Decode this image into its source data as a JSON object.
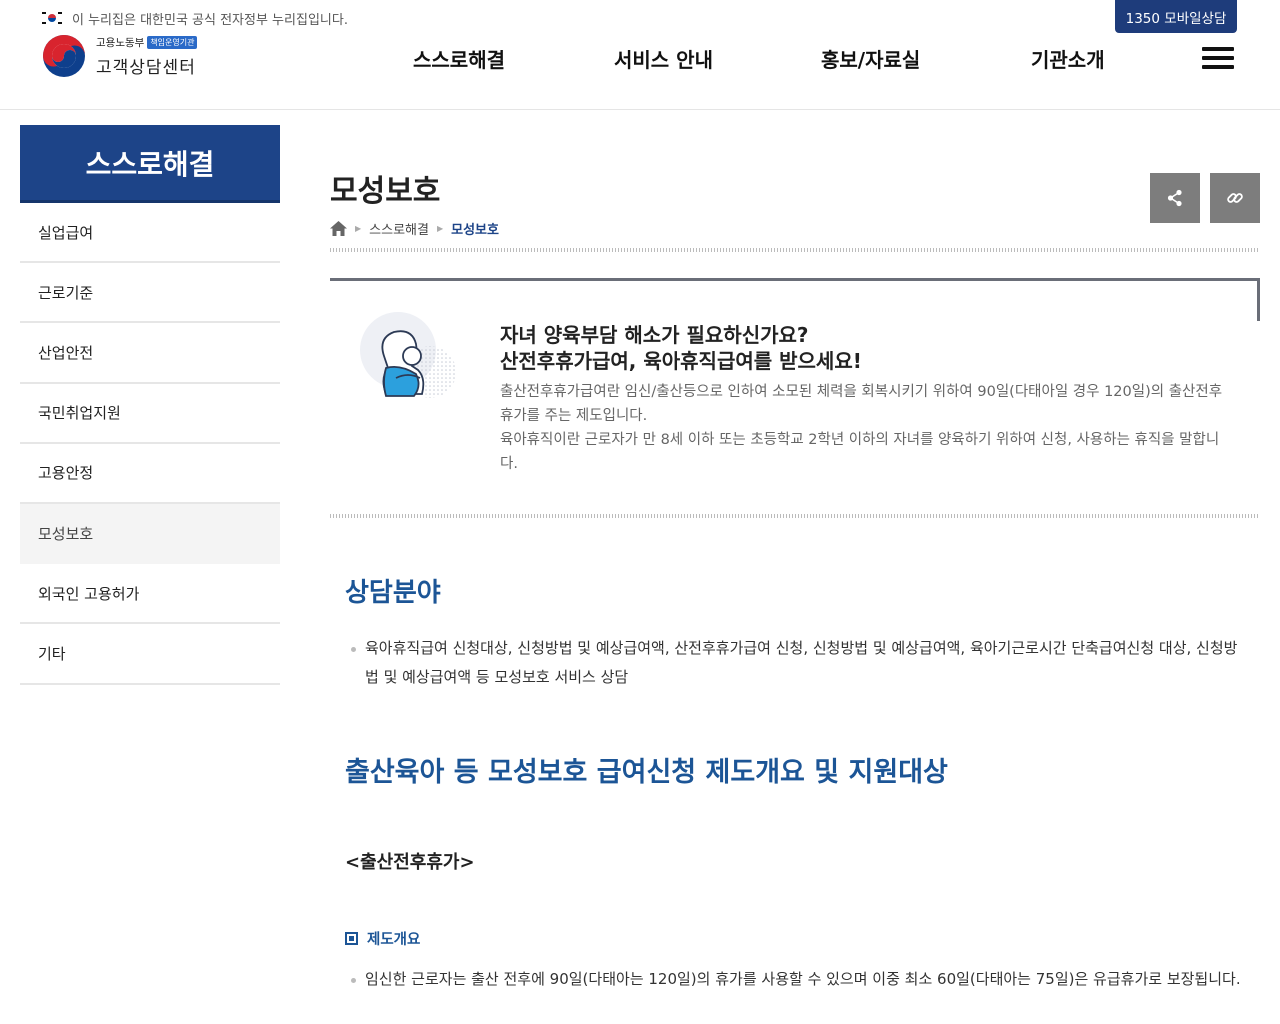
{
  "gov_notice": "이 누리집은 대한민국 공식 전자정부 누리집입니다.",
  "mobile_consult": "1350 모바일상담",
  "logo": {
    "ministry": "고용노동부",
    "badge": "책임운영기관",
    "name": "고객상담센터"
  },
  "nav": [
    "스스로해결",
    "서비스 안내",
    "홍보/자료실",
    "기관소개"
  ],
  "sidebar": {
    "title": "스스로해결",
    "items": [
      "실업급여",
      "근로기준",
      "산업안전",
      "국민취업지원",
      "고용안정",
      "모성보호",
      "외국인 고용허가",
      "기타"
    ],
    "active_index": 5
  },
  "page": {
    "title": "모성보호",
    "breadcrumb": [
      "스스로해결",
      "모성보호"
    ]
  },
  "intro": {
    "headline1": "자녀 양육부담 해소가 필요하신가요?",
    "headline2": "산전후휴가급여, 육아휴직급여를 받으세요!",
    "desc1": "출산전후휴가급여란 임신/출산등으로 인하여 소모된 체력을 회복시키기 위하여 90일(다태아일 경우 120일)의 출산전후휴가를 주는 제도입니다.",
    "desc2": "육아휴직이란 근로자가 만 8세 이하 또는 초등학교 2학년 이하의 자녀를 양육하기 위하여 신청, 사용하는 휴직을 말합니다."
  },
  "sections": {
    "consult_title": "상담분야",
    "consult_text": "육아휴직급여 신청대상, 신청방법 및 예상급여액, 산전후휴가급여 신청, 신청방법 및 예상급여액, 육아기근로시간 단축급여신청 대상, 신청방법 및 예상급여액 등 모성보호 서비스 상담",
    "overview_title": "출산육아 등 모성보호 급여신청 제도개요 및 지원대상",
    "sub_head": "<출산전후휴가>",
    "system_label": "제도개요",
    "system_text": "임신한 근로자는 출산 전후에 90일(다태아는 120일)의 휴가를 사용할 수 있으며 이중 최소 60일(다태아는 75일)은 유급휴가로 보장됩니다."
  },
  "colors": {
    "navy": "#1d4488",
    "section_blue": "#1c5596",
    "button_gray": "#7d7d7d"
  }
}
